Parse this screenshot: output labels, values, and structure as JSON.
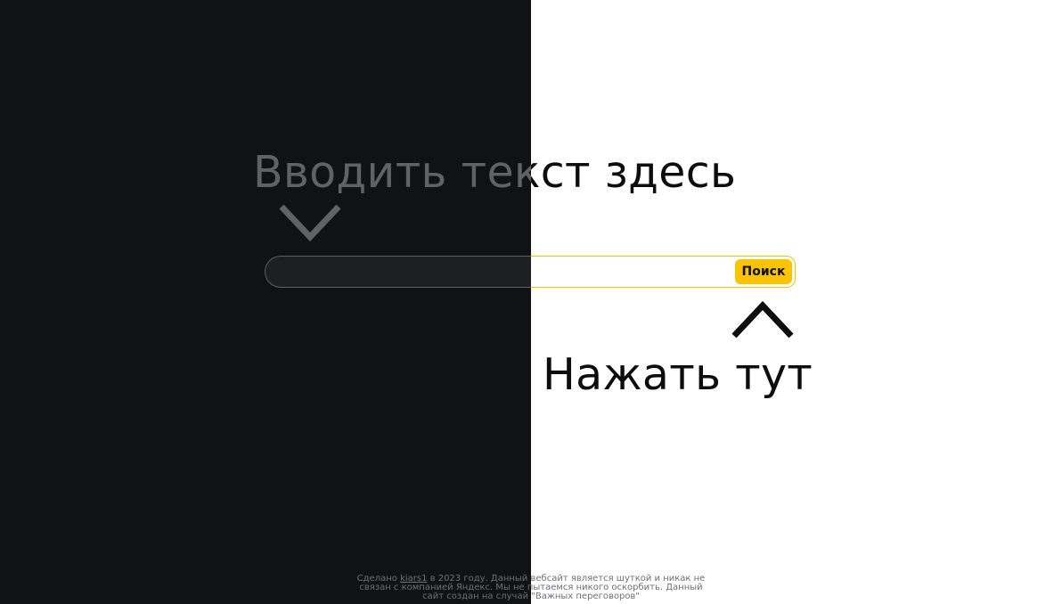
{
  "hints": {
    "input_hint": "Вводить текст здесь",
    "click_hint": "Нажать тут"
  },
  "search": {
    "value": "",
    "placeholder": "",
    "button_label": "Поиск"
  },
  "footer": {
    "prefix": "Сделано ",
    "author_link": "kiars1",
    "suffix": " в 2023 году. Данный вебсайт является шуткой и никак не связан с компанией Яндекс. Мы не пытаемся никого оскорбить. Данный сайт создан на случай \"Важных переговоров\""
  },
  "icons": {
    "down_arrow": "chevron-down-icon",
    "up_arrow": "chevron-up-icon"
  },
  "colors": {
    "dark_background": "#111214",
    "light_background": "#ffffff",
    "accent": "#fbc400",
    "muted_text": "#606266"
  }
}
